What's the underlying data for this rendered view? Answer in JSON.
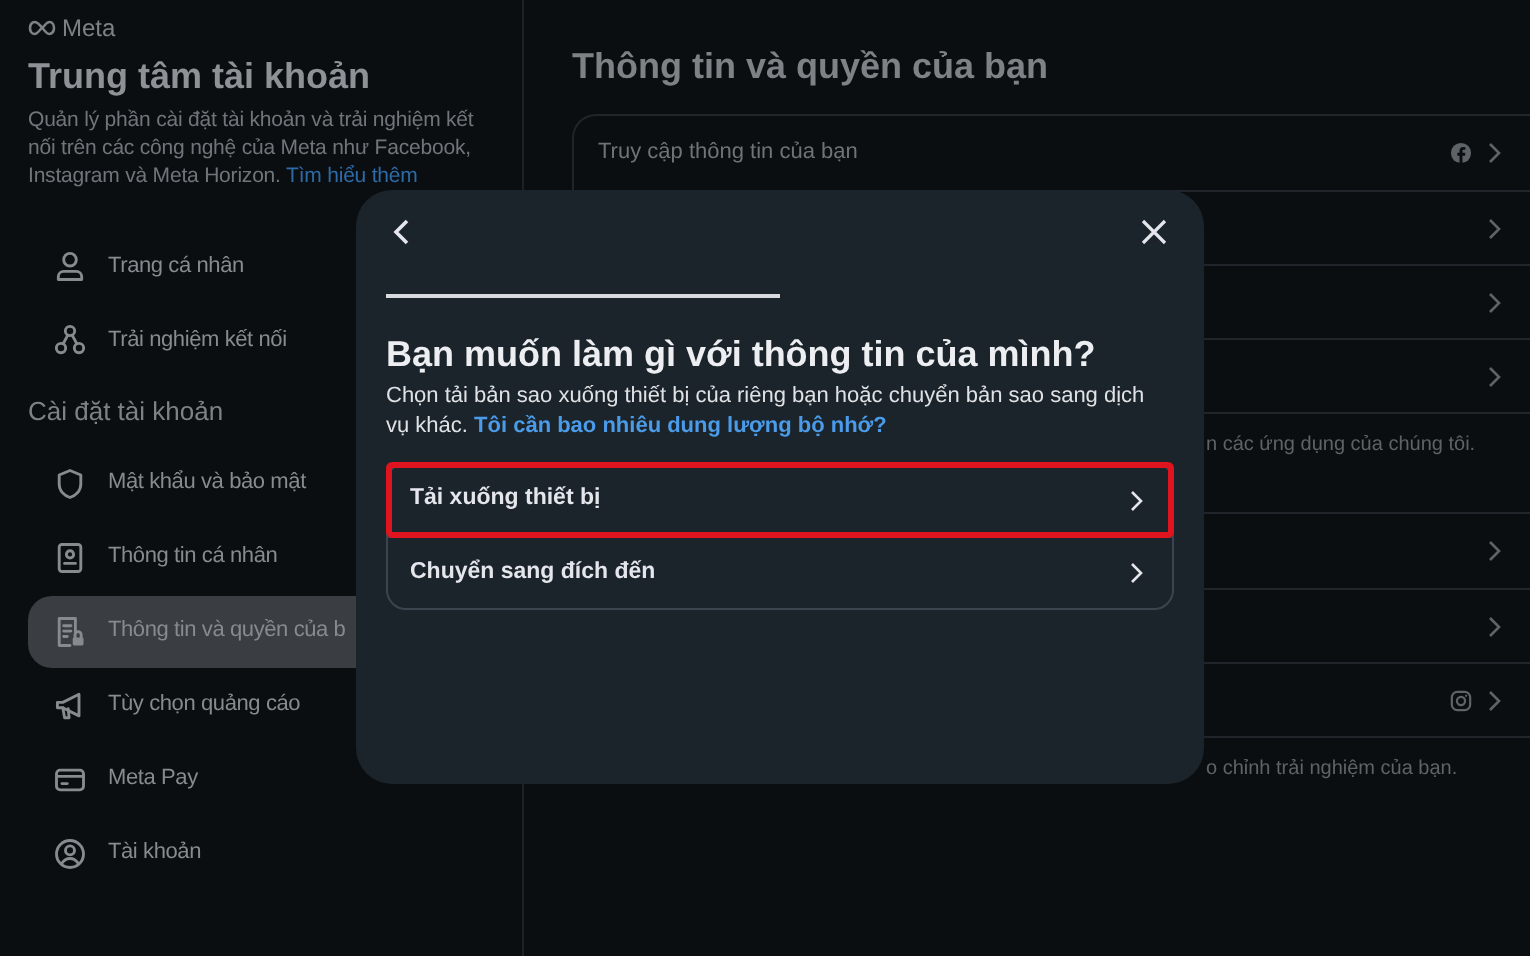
{
  "sidebar": {
    "brand": "Meta",
    "title": "Trung tâm tài khoản",
    "description": "Quản lý phần cài đặt tài khoản và trải nghiệm kết nối trên các công nghệ của Meta như Facebook, Instagram và Meta Horizon.",
    "learn_more": "Tìm hiểu thêm",
    "items": [
      {
        "kind": "profile",
        "label": "Trang cá nhân",
        "selected": false
      },
      {
        "kind": "connected",
        "label": "Trải nghiệm kết nối",
        "selected": false
      }
    ],
    "section": "Cài đặt tài khoản",
    "settings": [
      {
        "kind": "shield",
        "label": "Mật khẩu và bảo mật",
        "selected": false
      },
      {
        "kind": "id",
        "label": "Thông tin cá nhân",
        "selected": false
      },
      {
        "kind": "doc",
        "label": "Thông tin và quyền của b",
        "selected": true
      },
      {
        "kind": "megaphone",
        "label": "Tùy chọn quảng cáo",
        "selected": false
      },
      {
        "kind": "card",
        "label": "Meta Pay",
        "selected": false
      },
      {
        "kind": "account",
        "label": "Tài khoản",
        "selected": false
      }
    ]
  },
  "main": {
    "title": "Thông tin và quyền của bạn",
    "group_1": {
      "rows": [
        {
          "label": "Truy cập thông tin của bạn",
          "kind": "facebook"
        },
        {
          "kind": "plain"
        },
        {
          "kind": "plain"
        },
        {
          "kind": "plain"
        }
      ],
      "note": "n các ứng dụng của chúng tôi."
    },
    "group_2": {
      "rows": [
        {
          "kind": "plain"
        },
        {
          "kind": "plain"
        },
        {
          "kind": "instagram"
        }
      ],
      "note": "o chỉnh trải nghiệm của bạn."
    }
  },
  "dialog": {
    "title": "Bạn muốn làm gì với thông tin của mình?",
    "description": "Chọn tải bản sao xuống thiết bị của riêng bạn hoặc chuyển bản sao sang dịch vụ khác.",
    "link": "Tôi cần bao nhiêu dung lượng bộ nhớ?",
    "options": [
      {
        "label": "Tải xuống thiết bị",
        "highlighted": true
      },
      {
        "label": "Chuyển sang đích đến",
        "highlighted": false
      }
    ]
  }
}
